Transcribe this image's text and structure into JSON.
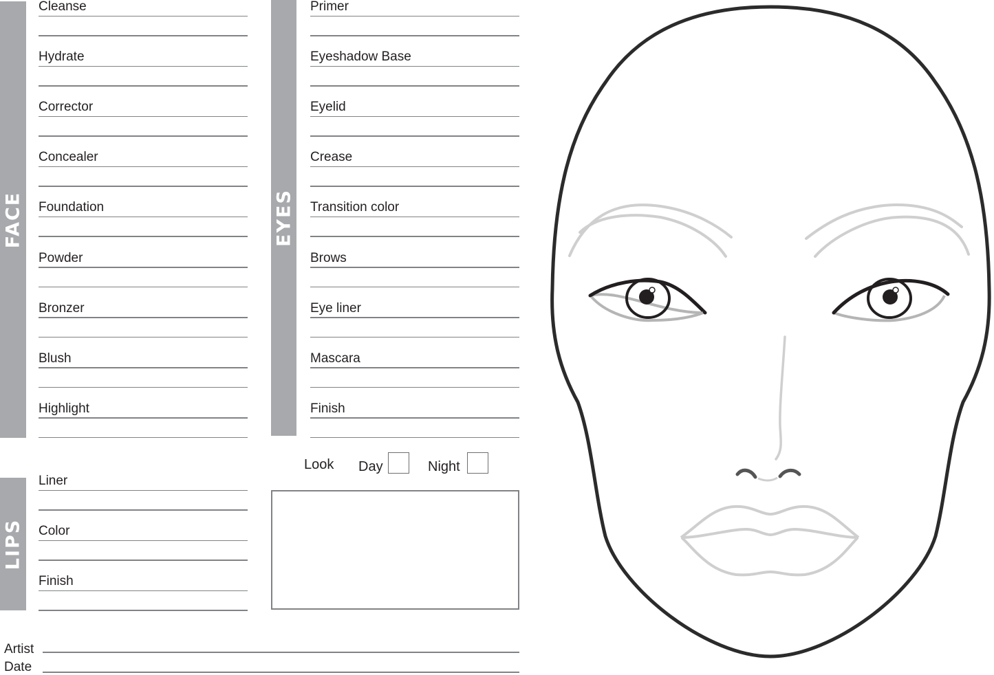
{
  "sections": {
    "face": {
      "title": "FACE",
      "items": [
        "Cleanse",
        "Hydrate",
        "Corrector",
        "Concealer",
        "Foundation",
        "Powder",
        "Bronzer",
        "Blush",
        "Highlight"
      ]
    },
    "eyes": {
      "title": "EYES",
      "items": [
        "Primer",
        "Eyeshadow Base",
        "Eyelid",
        "Crease",
        "Transition color",
        "Brows",
        "Eye liner",
        "Mascara",
        "Finish"
      ]
    },
    "lips": {
      "title": "LIPS",
      "items": [
        "Liner",
        "Color",
        "Finish"
      ]
    }
  },
  "look": {
    "label": "Look",
    "options": [
      {
        "label": "Day",
        "checked": false
      },
      {
        "label": "Night",
        "checked": false
      }
    ],
    "notes": ""
  },
  "footer": {
    "artist_label": "Artist",
    "artist_value": "",
    "date_label": "Date",
    "date_value": ""
  },
  "colors": {
    "bar": "#a7a9ac",
    "text": "#231f20",
    "rule": "#808285",
    "face_outline": "#2b2b2b",
    "face_detail": "#c8c8c8"
  }
}
